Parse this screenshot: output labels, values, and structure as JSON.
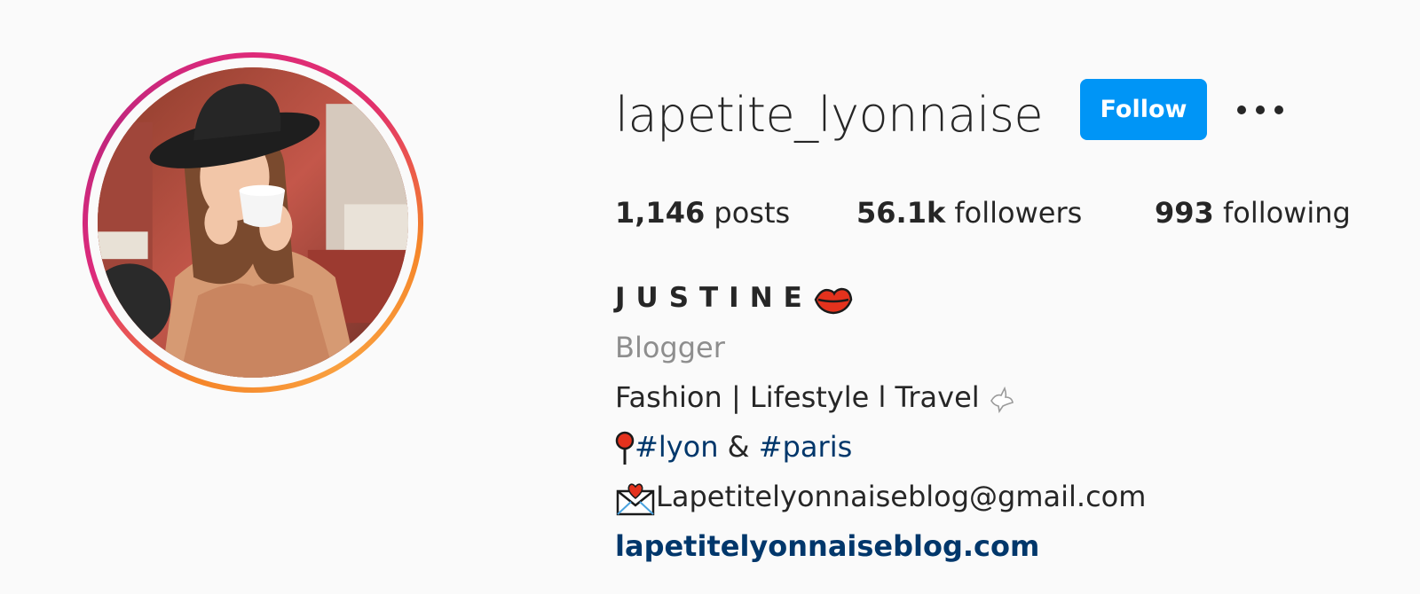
{
  "profile": {
    "username": "lapetite_lyonnaise",
    "follow_label": "Follow",
    "more_icon": "more-options-icon",
    "avatar_icon": "profile-photo"
  },
  "stats": {
    "posts_count": "1,146",
    "posts_label": "posts",
    "followers_count": "56.1k",
    "followers_label": "followers",
    "following_count": "993",
    "following_label": "following"
  },
  "bio": {
    "name": "JUSTINE",
    "name_emoji": "kiss-lips-icon",
    "category": "Blogger",
    "tagline": "Fashion | Lifestyle l Travel",
    "tagline_emoji": "dove-icon",
    "pin_emoji": "pin-icon",
    "hashtag_1": "#lyon",
    "hashtag_sep": "&",
    "hashtag_2": "#paris",
    "email_emoji": "love-letter-icon",
    "email": "Lapetitelyonnaiseblog@gmail.com",
    "website": "lapetitelyonnaiseblog.com"
  },
  "colors": {
    "background": "#fafafa",
    "follow_button": "#0095f6",
    "link": "#00376b",
    "muted_text": "#8e8e8e",
    "ring_start": "#f58529",
    "ring_end": "#dd2a7b"
  }
}
